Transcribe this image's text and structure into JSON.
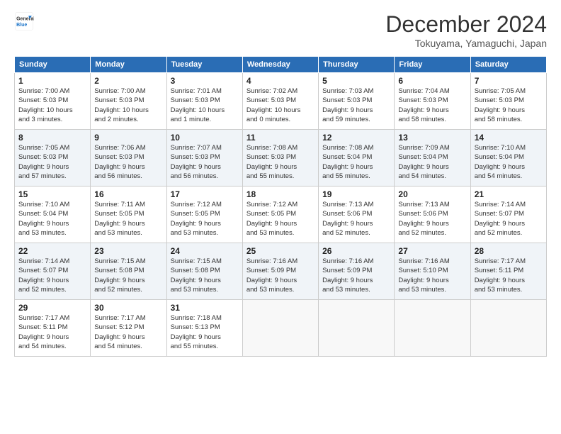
{
  "header": {
    "logo_line1": "General",
    "logo_line2": "Blue",
    "title": "December 2024",
    "location": "Tokuyama, Yamaguchi, Japan"
  },
  "days_of_week": [
    "Sunday",
    "Monday",
    "Tuesday",
    "Wednesday",
    "Thursday",
    "Friday",
    "Saturday"
  ],
  "weeks": [
    [
      {
        "day": "1",
        "info": "Sunrise: 7:00 AM\nSunset: 5:03 PM\nDaylight: 10 hours\nand 3 minutes."
      },
      {
        "day": "2",
        "info": "Sunrise: 7:00 AM\nSunset: 5:03 PM\nDaylight: 10 hours\nand 2 minutes."
      },
      {
        "day": "3",
        "info": "Sunrise: 7:01 AM\nSunset: 5:03 PM\nDaylight: 10 hours\nand 1 minute."
      },
      {
        "day": "4",
        "info": "Sunrise: 7:02 AM\nSunset: 5:03 PM\nDaylight: 10 hours\nand 0 minutes."
      },
      {
        "day": "5",
        "info": "Sunrise: 7:03 AM\nSunset: 5:03 PM\nDaylight: 9 hours\nand 59 minutes."
      },
      {
        "day": "6",
        "info": "Sunrise: 7:04 AM\nSunset: 5:03 PM\nDaylight: 9 hours\nand 58 minutes."
      },
      {
        "day": "7",
        "info": "Sunrise: 7:05 AM\nSunset: 5:03 PM\nDaylight: 9 hours\nand 58 minutes."
      }
    ],
    [
      {
        "day": "8",
        "info": "Sunrise: 7:05 AM\nSunset: 5:03 PM\nDaylight: 9 hours\nand 57 minutes."
      },
      {
        "day": "9",
        "info": "Sunrise: 7:06 AM\nSunset: 5:03 PM\nDaylight: 9 hours\nand 56 minutes."
      },
      {
        "day": "10",
        "info": "Sunrise: 7:07 AM\nSunset: 5:03 PM\nDaylight: 9 hours\nand 56 minutes."
      },
      {
        "day": "11",
        "info": "Sunrise: 7:08 AM\nSunset: 5:03 PM\nDaylight: 9 hours\nand 55 minutes."
      },
      {
        "day": "12",
        "info": "Sunrise: 7:08 AM\nSunset: 5:04 PM\nDaylight: 9 hours\nand 55 minutes."
      },
      {
        "day": "13",
        "info": "Sunrise: 7:09 AM\nSunset: 5:04 PM\nDaylight: 9 hours\nand 54 minutes."
      },
      {
        "day": "14",
        "info": "Sunrise: 7:10 AM\nSunset: 5:04 PM\nDaylight: 9 hours\nand 54 minutes."
      }
    ],
    [
      {
        "day": "15",
        "info": "Sunrise: 7:10 AM\nSunset: 5:04 PM\nDaylight: 9 hours\nand 53 minutes."
      },
      {
        "day": "16",
        "info": "Sunrise: 7:11 AM\nSunset: 5:05 PM\nDaylight: 9 hours\nand 53 minutes."
      },
      {
        "day": "17",
        "info": "Sunrise: 7:12 AM\nSunset: 5:05 PM\nDaylight: 9 hours\nand 53 minutes."
      },
      {
        "day": "18",
        "info": "Sunrise: 7:12 AM\nSunset: 5:05 PM\nDaylight: 9 hours\nand 53 minutes."
      },
      {
        "day": "19",
        "info": "Sunrise: 7:13 AM\nSunset: 5:06 PM\nDaylight: 9 hours\nand 52 minutes."
      },
      {
        "day": "20",
        "info": "Sunrise: 7:13 AM\nSunset: 5:06 PM\nDaylight: 9 hours\nand 52 minutes."
      },
      {
        "day": "21",
        "info": "Sunrise: 7:14 AM\nSunset: 5:07 PM\nDaylight: 9 hours\nand 52 minutes."
      }
    ],
    [
      {
        "day": "22",
        "info": "Sunrise: 7:14 AM\nSunset: 5:07 PM\nDaylight: 9 hours\nand 52 minutes."
      },
      {
        "day": "23",
        "info": "Sunrise: 7:15 AM\nSunset: 5:08 PM\nDaylight: 9 hours\nand 52 minutes."
      },
      {
        "day": "24",
        "info": "Sunrise: 7:15 AM\nSunset: 5:08 PM\nDaylight: 9 hours\nand 53 minutes."
      },
      {
        "day": "25",
        "info": "Sunrise: 7:16 AM\nSunset: 5:09 PM\nDaylight: 9 hours\nand 53 minutes."
      },
      {
        "day": "26",
        "info": "Sunrise: 7:16 AM\nSunset: 5:09 PM\nDaylight: 9 hours\nand 53 minutes."
      },
      {
        "day": "27",
        "info": "Sunrise: 7:16 AM\nSunset: 5:10 PM\nDaylight: 9 hours\nand 53 minutes."
      },
      {
        "day": "28",
        "info": "Sunrise: 7:17 AM\nSunset: 5:11 PM\nDaylight: 9 hours\nand 53 minutes."
      }
    ],
    [
      {
        "day": "29",
        "info": "Sunrise: 7:17 AM\nSunset: 5:11 PM\nDaylight: 9 hours\nand 54 minutes."
      },
      {
        "day": "30",
        "info": "Sunrise: 7:17 AM\nSunset: 5:12 PM\nDaylight: 9 hours\nand 54 minutes."
      },
      {
        "day": "31",
        "info": "Sunrise: 7:18 AM\nSunset: 5:13 PM\nDaylight: 9 hours\nand 55 minutes."
      },
      {
        "day": "",
        "info": ""
      },
      {
        "day": "",
        "info": ""
      },
      {
        "day": "",
        "info": ""
      },
      {
        "day": "",
        "info": ""
      }
    ]
  ]
}
